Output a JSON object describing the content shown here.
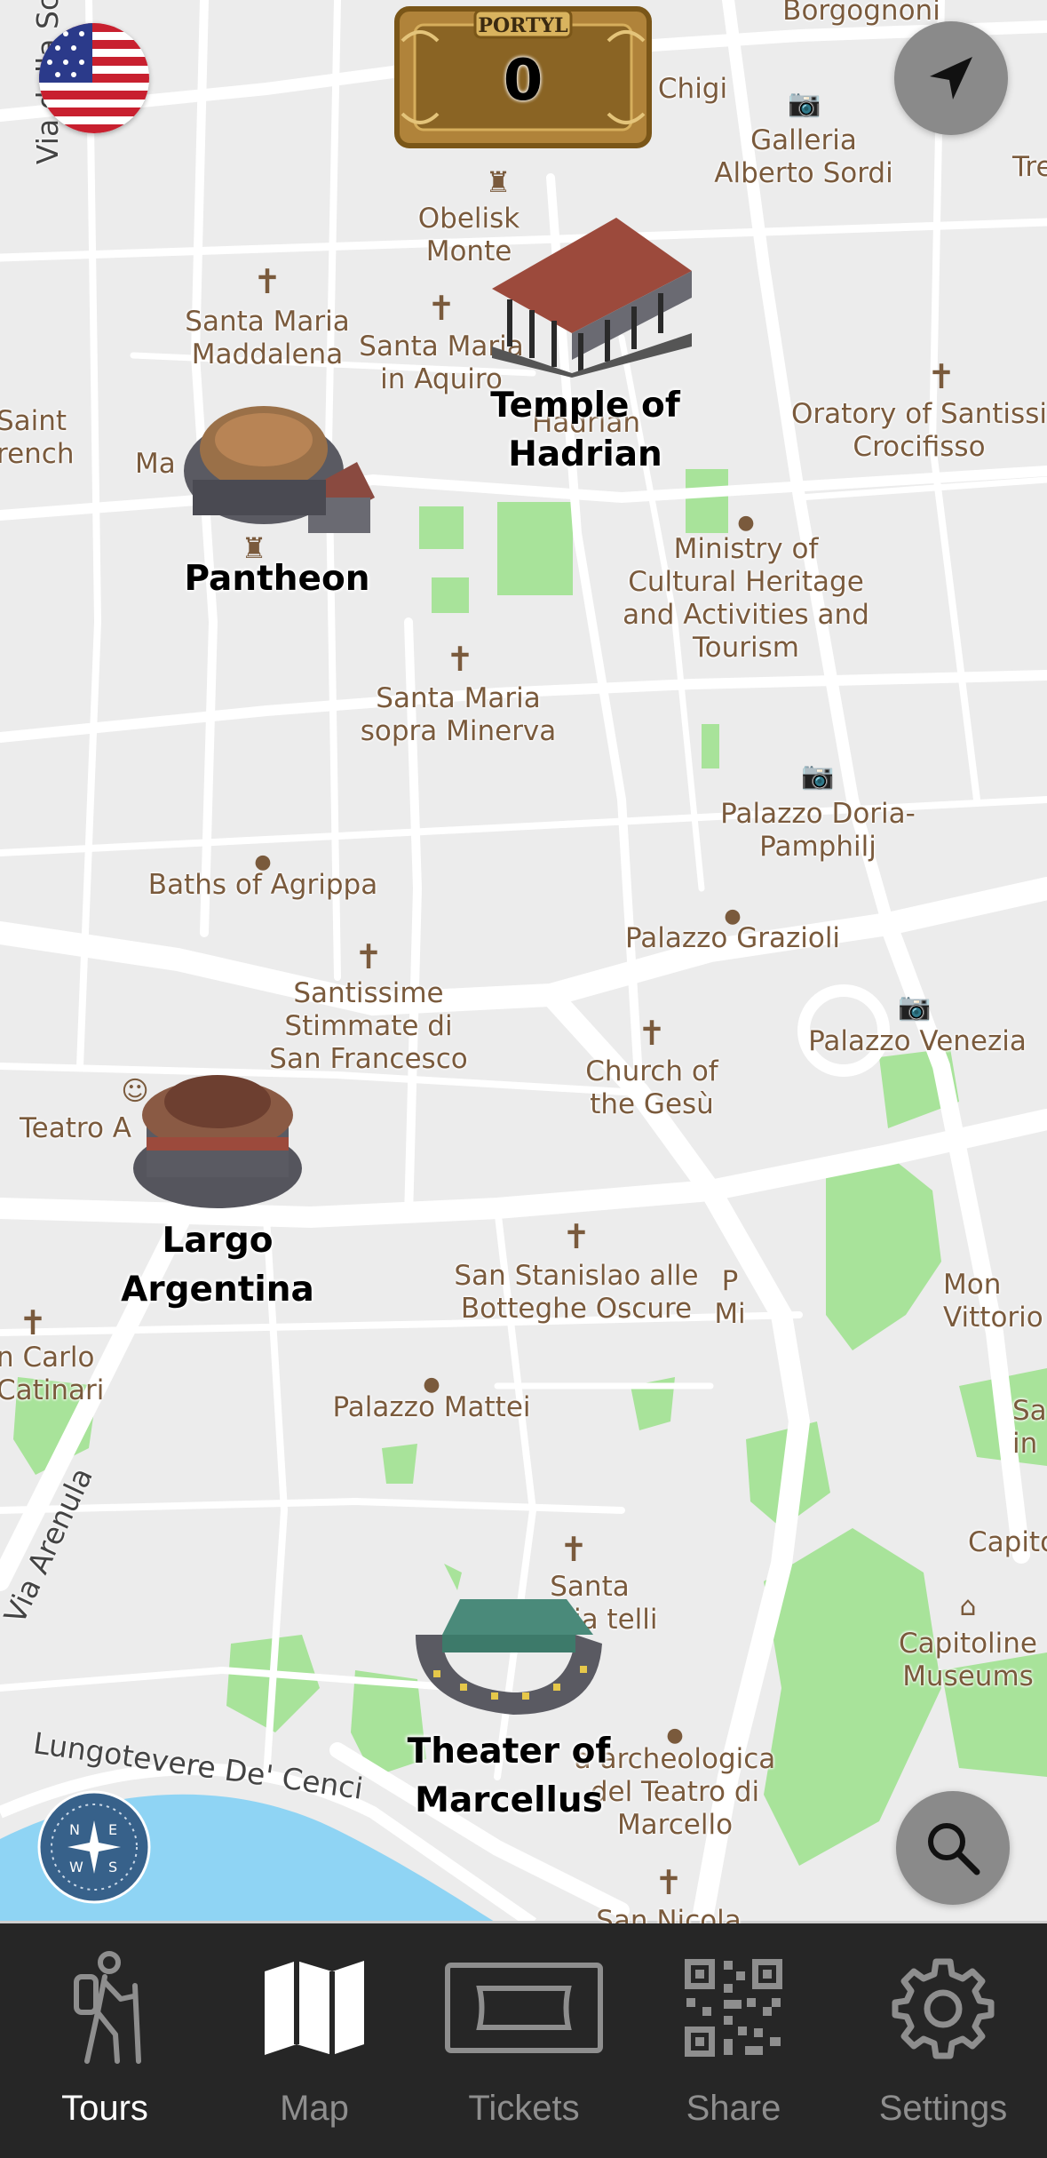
{
  "app": {
    "counter_brand": "PORTYL",
    "counter_value": "0"
  },
  "map": {
    "sites": [
      {
        "id": "temple",
        "name": "Temple of Hadrian"
      },
      {
        "id": "pantheon",
        "name": "Pantheon"
      },
      {
        "id": "largo",
        "name": "Largo Argentina"
      },
      {
        "id": "theater",
        "name": "Theater of Marcellus"
      }
    ],
    "labels": [
      "Borgognoni",
      "Chigi",
      "Galleria Alberto Sordi",
      "Tre",
      "Obelisk Monte",
      "Santa Maria Maddalena",
      "Santa Maria in Aquiro",
      "Hadrian",
      "Oratory of Santissi Crocifisso",
      "Saint rench",
      "Ma",
      "Ministry of Cultural Heritage and Activities and Tourism",
      "Santa Maria sopra Minerva",
      "Palazzo Doria-Pamphilj",
      "Baths of Agrippa",
      "Palazzo Grazioli",
      "Santissime Stimmate di San Francesco",
      "Church of the Gesù",
      "Palazzo Venezia",
      "Teatro A",
      "San Stanislao alle Botteghe Oscure",
      "P Mi",
      "Mon Vittorio",
      "n Carlo Catinari",
      "Palazzo Mattei",
      "Sa in",
      "Capito",
      "Capitoline Museums",
      "Santa Maria telli",
      "a archeologica del Teatro di Marcello",
      "San Nicola"
    ],
    "streets": {
      "via_della_sc": "Via della Sc",
      "via_arenula": "Via Arenula",
      "lungotevere": "Lungotevere De' Cenci"
    }
  },
  "icons": {
    "flag": "us-flag-icon",
    "locate": "location-arrow-icon",
    "search": "search-icon",
    "compass": "compass-icon"
  },
  "tabs": [
    {
      "label": "Tours",
      "icon": "hiker-icon",
      "active": true
    },
    {
      "label": "Map",
      "icon": "map-icon",
      "active": false
    },
    {
      "label": "Tickets",
      "icon": "ticket-icon",
      "active": false
    },
    {
      "label": "Share",
      "icon": "qr-code-icon",
      "active": false
    },
    {
      "label": "Settings",
      "icon": "gear-icon",
      "active": false
    }
  ],
  "colors": {
    "tabbar_bg": "#262626",
    "tab_active": "#ffffff",
    "tab_inactive": "#8e8e8e",
    "park": "#a8e39a",
    "water": "#8fd4f4",
    "poi_text": "#7a5a3c"
  }
}
